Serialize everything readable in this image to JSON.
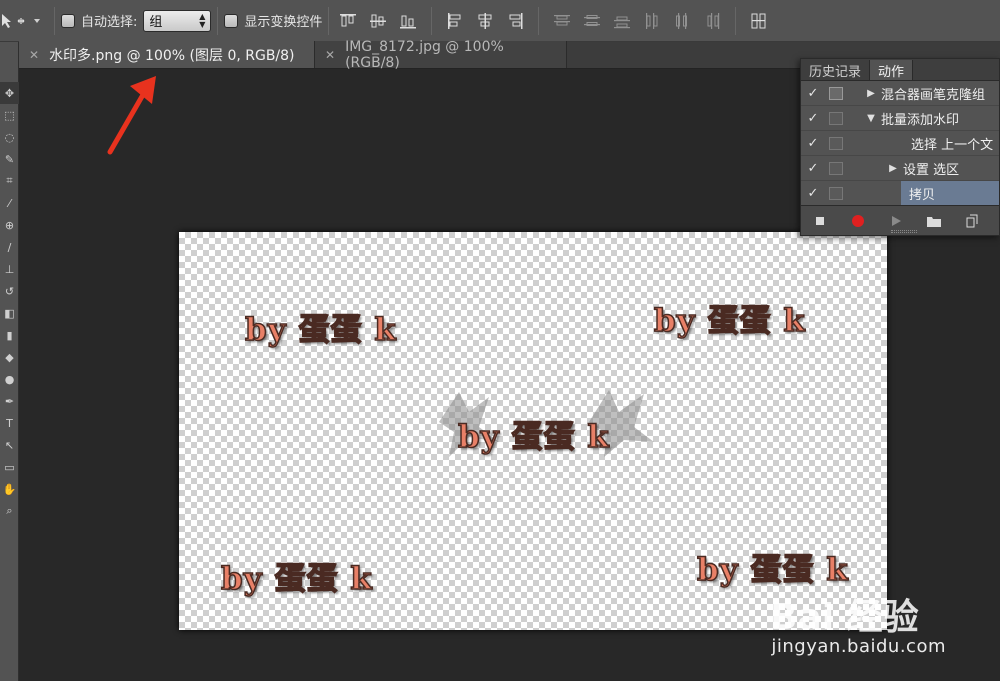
{
  "options_bar": {
    "auto_select_label": "自动选择:",
    "auto_select_value": "组",
    "show_transform_label": "显示变换控件"
  },
  "tabs": [
    {
      "label": "水印多.png @ 100% (图层 0, RGB/8)",
      "active": true
    },
    {
      "label": "IMG_8172.jpg @ 100%(RGB/8)",
      "active": false
    }
  ],
  "panel": {
    "tabs": [
      "历史记录",
      "动作"
    ],
    "actions": [
      {
        "check": "✓",
        "label": "混合器画笔克隆组",
        "indent": 1,
        "expand": "▶"
      },
      {
        "check": "✓",
        "label": "批量添加水印",
        "indent": 1,
        "expand": "▼"
      },
      {
        "check": "✓",
        "label": "选择 上一个文",
        "indent": 2,
        "expand": ""
      },
      {
        "check": "✓",
        "label": "设置 选区",
        "indent": 2,
        "expand": "▶"
      },
      {
        "check": "✓",
        "label": "拷贝",
        "indent": 2,
        "expand": "",
        "highlighted": true
      }
    ]
  },
  "watermarks": [
    "by 蛋蛋 k",
    "by 蛋蛋 k",
    "by 蛋蛋 k",
    "by 蛋蛋 k",
    "by 蛋蛋 k"
  ],
  "site_watermark": {
    "logo_text": "Bai 经验",
    "url": "jingyan.baidu.com"
  },
  "colors": {
    "accent_arrow": "#e8321e",
    "watermark_fill": "#e88067",
    "record_button": "#e02020",
    "highlight_row": "#6a7b93"
  }
}
